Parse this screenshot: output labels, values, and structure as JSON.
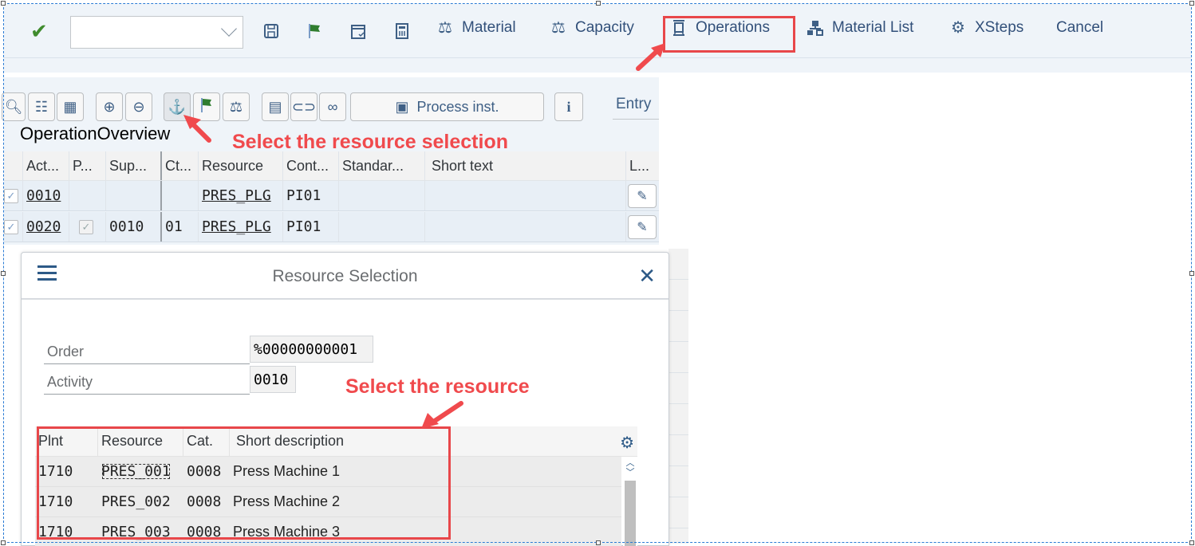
{
  "toolbar": {
    "command_field": {
      "value": "",
      "placeholder": ""
    },
    "icons": [
      "confirm-icon",
      "save-icon",
      "flag-icon",
      "calendar-check-icon",
      "calculator-icon"
    ],
    "buttons": [
      {
        "label": "Material",
        "icon": "balance-icon"
      },
      {
        "label": "Capacity",
        "icon": "balance-icon"
      },
      {
        "label": "Operations",
        "icon": "operations-icon",
        "highlighted": true
      },
      {
        "label": "Material List",
        "icon": "hierarchy-icon"
      },
      {
        "label": "XSteps",
        "icon": "gear-net-icon"
      },
      {
        "label": "Cancel"
      }
    ]
  },
  "subtoolbar": {
    "process_inst_label": "Process inst.",
    "entry_label": "Entry",
    "icons": [
      "zoom-check-icon",
      "list-icon",
      "grid-icon",
      "expand-icon",
      "collapse-icon",
      "resource-selection-icon",
      "flag-icon",
      "balance-icon",
      "form-icon",
      "link-icon",
      "binoculars-icon",
      "info-icon"
    ]
  },
  "overview": {
    "title": "OperationOverview",
    "columns": [
      "Act...",
      "P...",
      "Sup...",
      "Ct...",
      "Resource",
      "Cont...",
      "Standar...",
      "Short text",
      "L..."
    ],
    "rows": [
      {
        "selected": true,
        "activity": "0010",
        "phase": false,
        "superior": "",
        "ctrl": "",
        "resource": "PRES_PLG",
        "control_key": "PI01",
        "standard": "",
        "short_text": ""
      },
      {
        "selected": true,
        "activity": "0020",
        "phase": true,
        "superior": "0010",
        "ctrl": "01",
        "resource": "PRES_PLG",
        "control_key": "PI01",
        "standard": "",
        "short_text": ""
      }
    ]
  },
  "dialog": {
    "title": "Resource Selection",
    "fields": [
      {
        "label": "Order",
        "value": "%00000000001"
      },
      {
        "label": "Activity",
        "value": "0010"
      }
    ],
    "table": {
      "columns": [
        "Plnt",
        "Resource",
        "Cat.",
        "Short description"
      ],
      "rows": [
        {
          "plant": "1710",
          "resource": "PRES_001",
          "cat": "0008",
          "description": "Press Machine 1",
          "focused": true
        },
        {
          "plant": "1710",
          "resource": "PRES_002",
          "cat": "0008",
          "description": "Press Machine 2"
        },
        {
          "plant": "1710",
          "resource": "PRES_003",
          "cat": "0008",
          "description": "Press Machine 3"
        }
      ]
    }
  },
  "annotations": {
    "resource_selection": "Select the resource selection",
    "select_resource": "Select the resource",
    "color": "#f04a4d"
  },
  "colors": {
    "toolbar_bg": "#eff4f9",
    "accent_text": "#32507a",
    "highlight_red": "#e8474a",
    "row_bg": "#e8eff6"
  }
}
